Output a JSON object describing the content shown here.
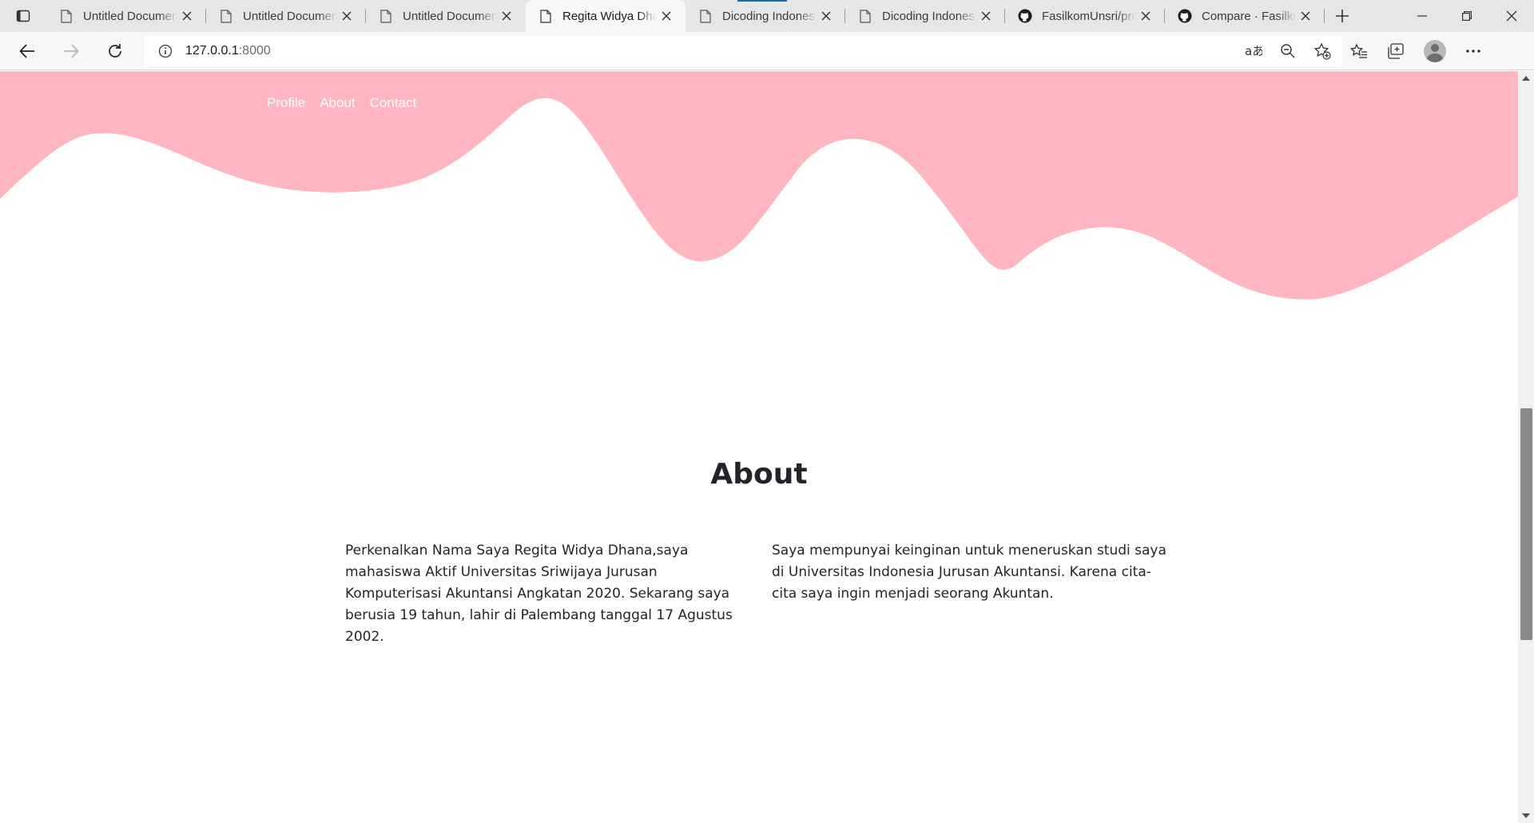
{
  "browser": {
    "tabs": [
      {
        "title": "Untitled Document",
        "icon": "page-icon"
      },
      {
        "title": "Untitled Document",
        "icon": "page-icon"
      },
      {
        "title": "Untitled Document",
        "icon": "page-icon"
      },
      {
        "title": "Regita Widya Dhana",
        "icon": "page-icon",
        "active": true
      },
      {
        "title": "Dicoding Indonesia",
        "icon": "page-icon"
      },
      {
        "title": "Dicoding Indonesia",
        "icon": "page-icon"
      },
      {
        "title": "FasilkomUnsri/pro",
        "icon": "github-icon"
      },
      {
        "title": "Compare · FasilkomUnsri",
        "icon": "github-icon"
      }
    ],
    "address": {
      "host": "127.0.0.1",
      "port": ":8000"
    }
  },
  "page": {
    "nav": {
      "profile": "Profile",
      "about": "About",
      "contact": "Contact"
    },
    "about": {
      "title": "About",
      "left_text": "Perkenalkan Nama Saya Regita Widya Dhana,saya mahasiswa Aktif Universitas Sriwijaya Jurusan Komputerisasi Akuntansi Angkatan 2020. Sekarang saya berusia 19 tahun, lahir di Palembang tanggal 17 Agustus 2002.",
      "right_text": "Saya mempunyai keinginan untuk meneruskan studi saya di Universitas Indonesia Jurusan Akuntansi. Karena cita-cita saya ingin menjadi seorang Akuntan."
    }
  },
  "colors": {
    "wave": "#ffb6c1",
    "accent": "#0f6cbd"
  }
}
